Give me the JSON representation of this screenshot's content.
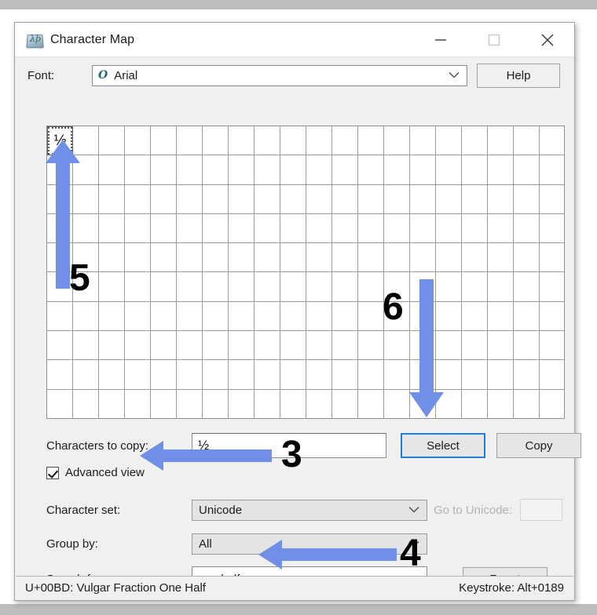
{
  "window": {
    "title": "Character Map",
    "icon": "charmap-icon",
    "controls": {
      "minimize": "minimize-icon",
      "maximize": "maximize-icon",
      "close": "close-icon"
    }
  },
  "font_row": {
    "label": "Font:",
    "value": "Arial",
    "type_icon": "O",
    "help_button": "Help"
  },
  "grid": {
    "columns": 20,
    "rows": 10,
    "selected_char": "½",
    "selected_index": 0
  },
  "chars_to_copy": {
    "label": "Characters to copy:",
    "value": "½",
    "select_button": "Select",
    "copy_button": "Copy"
  },
  "advanced_view": {
    "label": "Advanced view",
    "checked": true
  },
  "character_set": {
    "label": "Character set:",
    "value": "Unicode",
    "goto_label": "Go to Unicode:",
    "goto_value": ""
  },
  "group_by": {
    "label": "Group by:",
    "value": "All"
  },
  "search": {
    "label": "Search for:",
    "value": "one half",
    "reset_button": "Reset"
  },
  "status_bar": {
    "codepoint": "U+00BD: Vulgar Fraction One Half",
    "keystroke": "Keystroke: Alt+0189"
  },
  "annotations": {
    "arrow_color": "#7090e8",
    "steps": [
      {
        "number": "3",
        "target": "advanced-view-checkbox",
        "direction": "left"
      },
      {
        "number": "4",
        "target": "search-input",
        "direction": "left"
      },
      {
        "number": "5",
        "target": "selected-char-cell",
        "direction": "up"
      },
      {
        "number": "6",
        "target": "select-button",
        "direction": "down"
      }
    ]
  }
}
